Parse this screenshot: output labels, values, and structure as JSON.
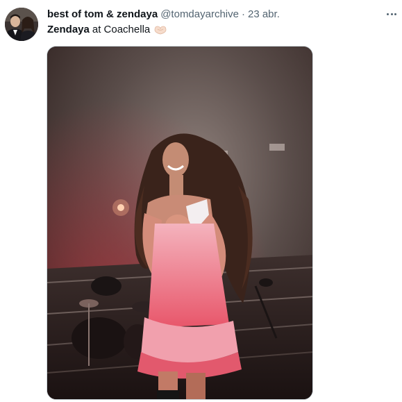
{
  "tweet": {
    "display_name": "best of tom & zendaya",
    "handle": "@tomdayarchive",
    "separator": "·",
    "timestamp": "23 abr.",
    "text_bold": "Zendaya",
    "text_rest": "at Coachella",
    "emoji": "heart-hands"
  },
  "icons": {
    "more": "more-horizontal-icon",
    "emoji": "heart-hands-emoji-icon"
  },
  "colors": {
    "text_primary": "#0f1419",
    "text_secondary": "#536471",
    "border": "#cfd9de",
    "stage_light": "#e8566a"
  }
}
